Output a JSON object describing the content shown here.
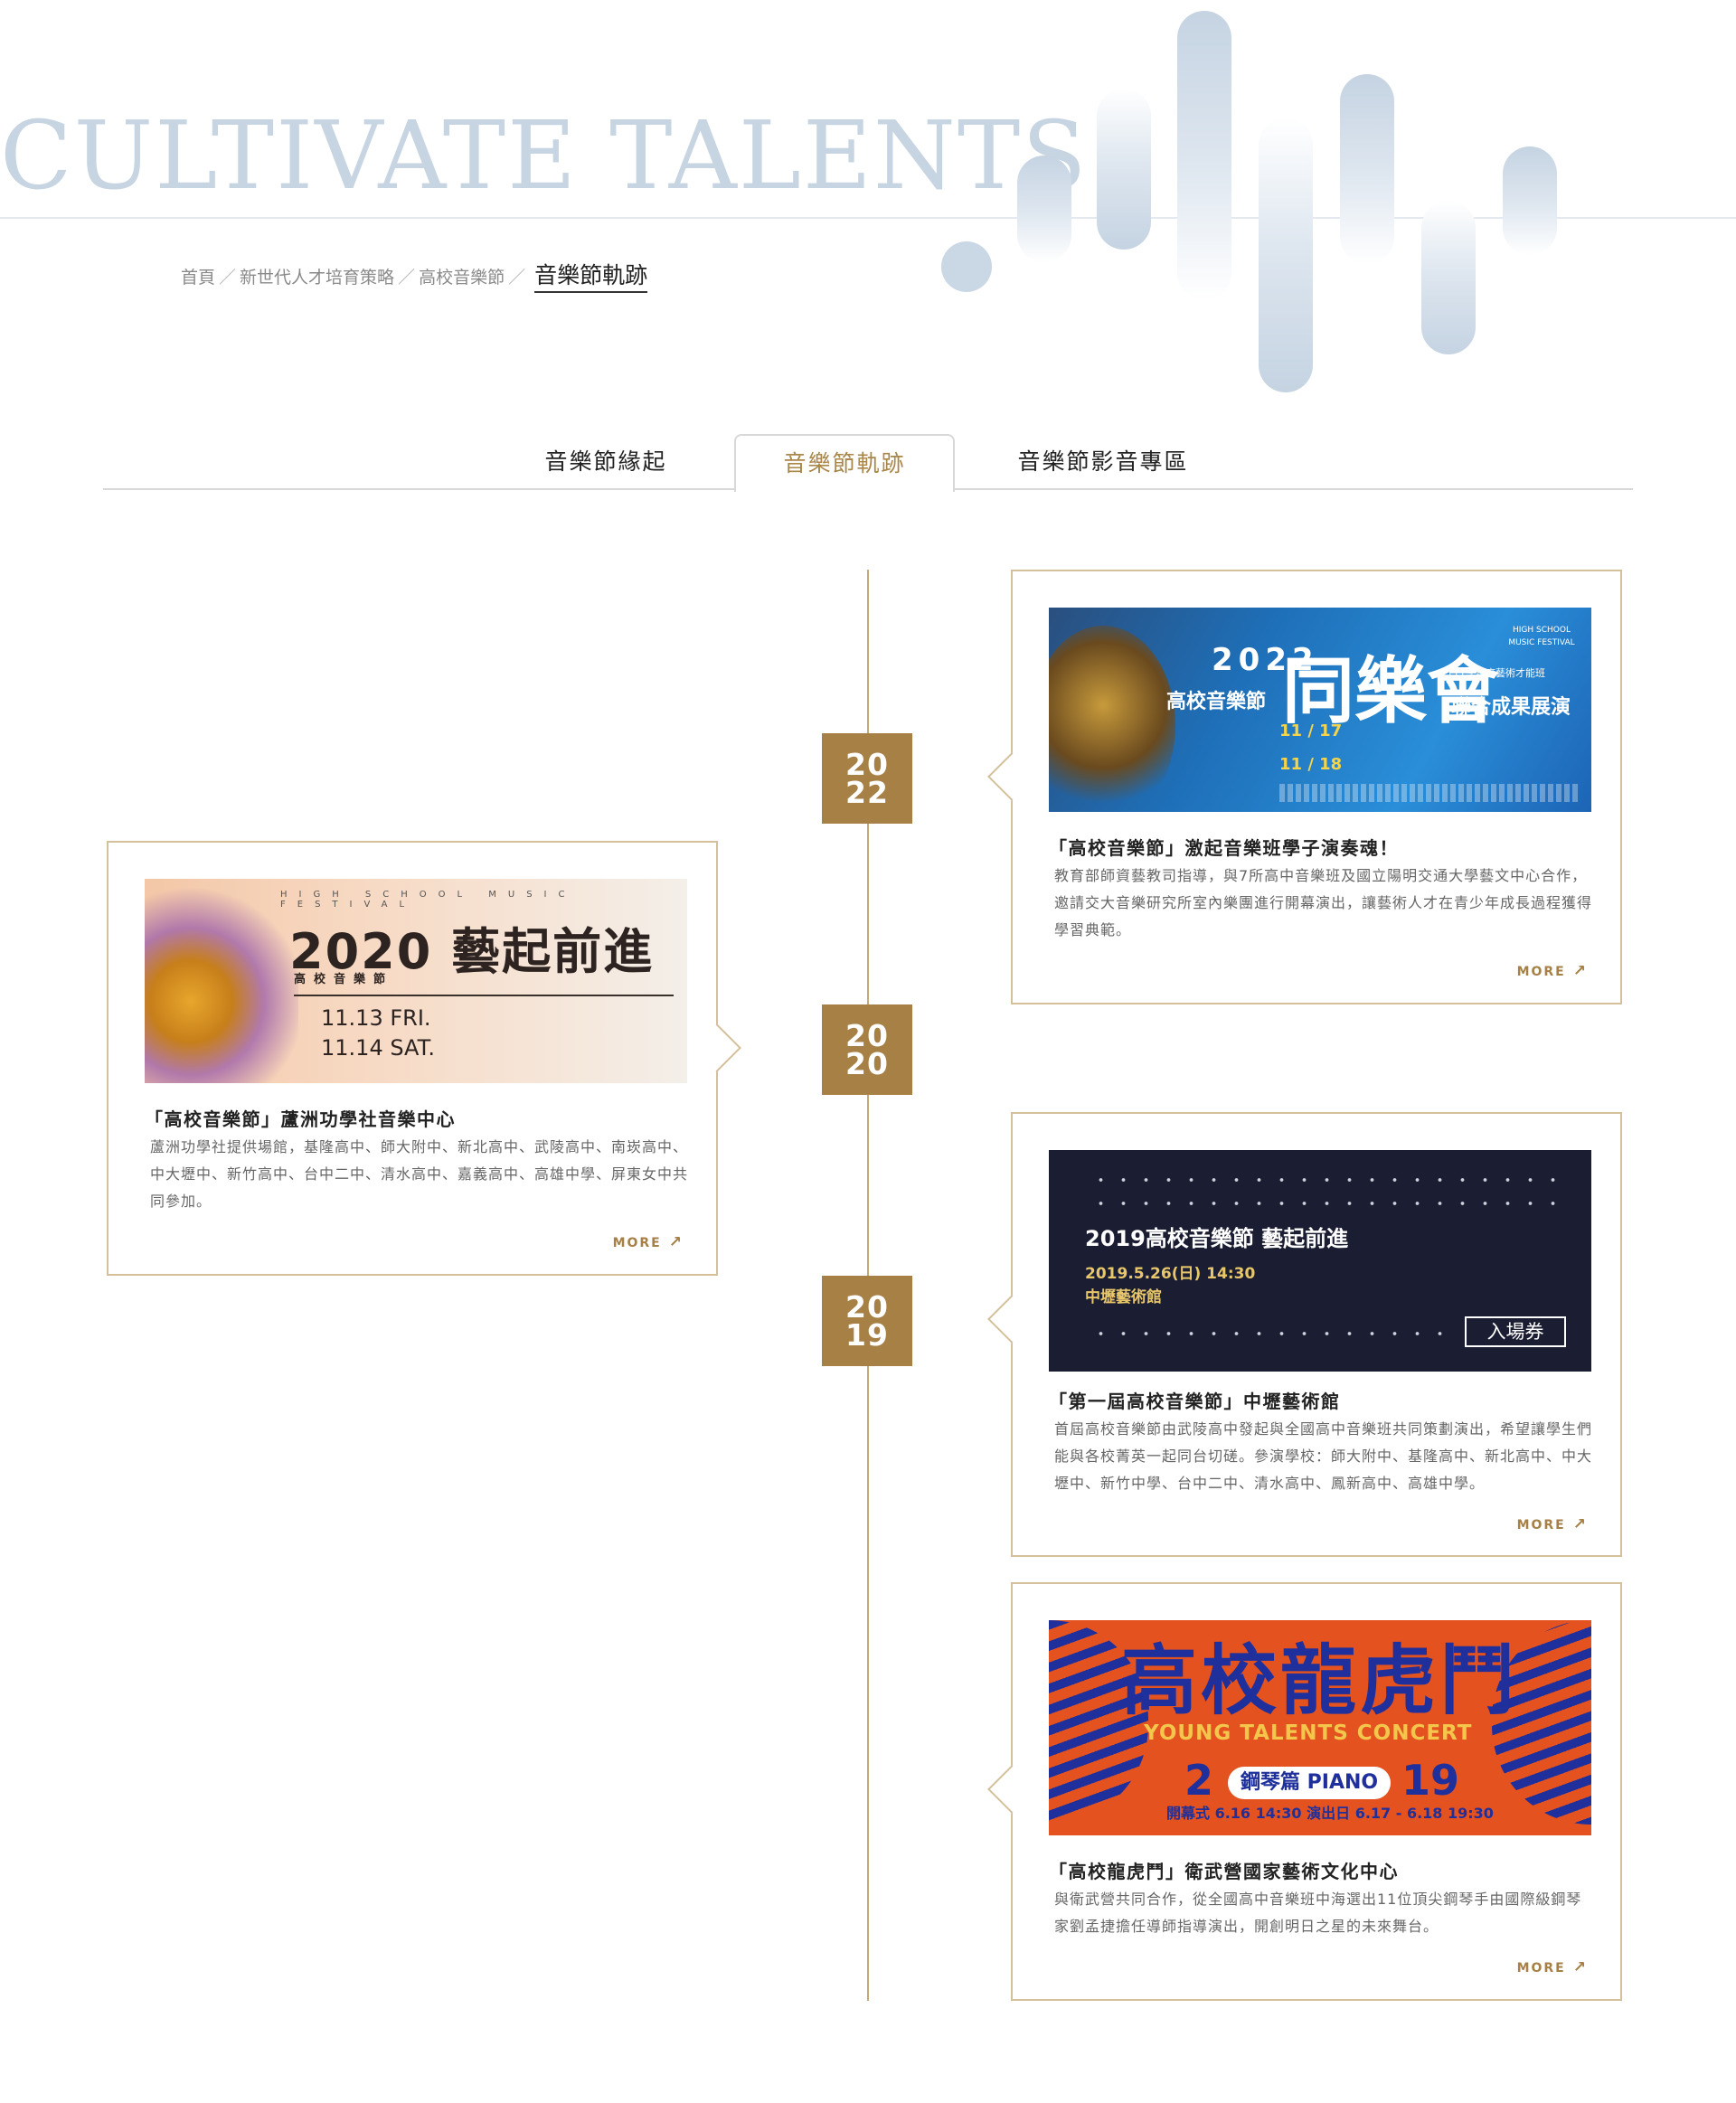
{
  "hero": {
    "title": "CULTIVATE TALENTS"
  },
  "breadcrumb": {
    "items": [
      "首頁",
      "新世代人才培育策略",
      "高校音樂節"
    ],
    "separator": "／",
    "current": "音樂節軌跡"
  },
  "tabs": [
    {
      "label": "音樂節緣起",
      "active": false
    },
    {
      "label": "音樂節軌跡",
      "active": true
    },
    {
      "label": "音樂節影音專區",
      "active": false
    }
  ],
  "colors": {
    "accent": "#a68045",
    "hero": "#c7d4e2",
    "border": "#d4c09a"
  },
  "timeline": {
    "years": [
      {
        "top": "20",
        "bottom": "22"
      },
      {
        "top": "20",
        "bottom": "20"
      },
      {
        "top": "20",
        "bottom": "19"
      }
    ],
    "more_label": "MORE",
    "more_icon": "arrow-up-right-icon",
    "entries": [
      {
        "title": "「高校音樂節」激起音樂班學子演奏魂！",
        "desc": "教育部師資藝教司指導，與7所高中音樂班及國立陽明交通大學藝文中心合作，邀請交大音樂研究所室內樂團進行開幕演出，讓藝術人才在青少年成長過程獲得學習典範。",
        "poster": {
          "year": "2022",
          "main": "同樂會",
          "festival": "高校音樂節",
          "subtitle": "111學年度藝術才能班",
          "subtitle2": "聯合成果展演",
          "corner": "HIGH SCHOOL MUSIC FESTIVAL",
          "date1": "11 / 17",
          "date2": "11 / 18"
        }
      },
      {
        "title": "「高校音樂節」蘆洲功學社音樂中心",
        "desc": "蘆洲功學社提供場館，基隆高中、師大附中、新北高中、武陵高中、南崁高中、中大壢中、新竹高中、台中二中、清水高中、嘉義高中、高雄中學、屏東女中共同參加。",
        "poster": {
          "header": "HIGH SCHOOL MUSIC FESTIVAL",
          "title": "2020 藝起前進",
          "sub": "高校音樂節",
          "date1": "11.13 FRI.",
          "date2": "11.14 SAT."
        }
      },
      {
        "title": "「第一屆高校音樂節」中壢藝術館",
        "desc": "首屆高校音樂節由武陵高中發起與全國高中音樂班共同策劃演出，希望讓學生們能與各校菁英一起同台切磋。參演學校：師大附中、基隆高中、新北高中、中大壢中、新竹中學、台中二中、清水高中、鳳新高中、高雄中學。",
        "poster": {
          "title": "2019高校音樂節  藝起前進",
          "date": "2019.5.26(日) 14:30",
          "venue": "中壢藝術館",
          "ticket": "入場券"
        }
      },
      {
        "title": "「高校龍虎鬥」衛武營國家藝術文化中心",
        "desc": "與衛武營共同合作，從全國高中音樂班中海選出11位頂尖鋼琴手由國際級鋼琴家劉孟捷擔任導師指導演出，開創明日之星的未來舞台。",
        "poster": {
          "title": "高校龍虎鬥",
          "subtitle": "YOUNG TALENTS CONCERT",
          "year_a": "2",
          "badge": "鋼琴篇 PIANO",
          "year_b": "19",
          "dates": "開幕式 6.16 14:30   演出日 6.17 - 6.18 19:30"
        }
      }
    ]
  }
}
